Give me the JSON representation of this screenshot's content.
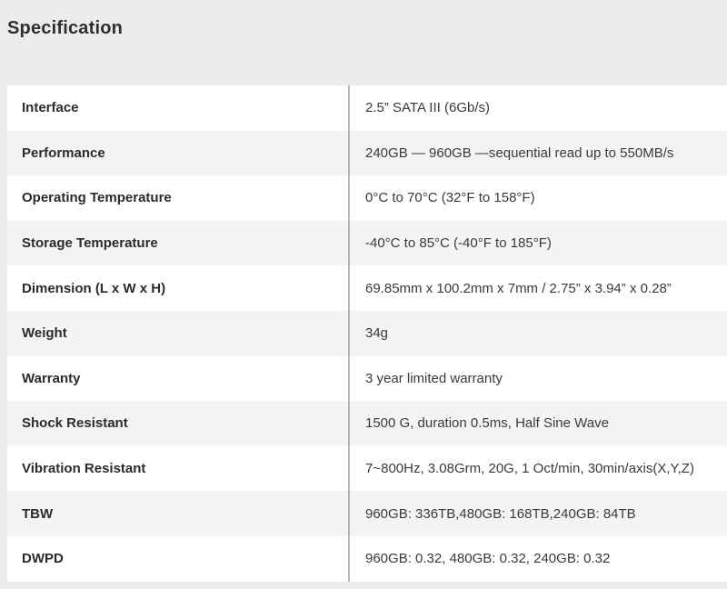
{
  "section": {
    "title": "Specification"
  },
  "specs": [
    {
      "label": "Interface",
      "value": "2.5” SATA III (6Gb/s)"
    },
    {
      "label": "Performance",
      "value": "240GB — 960GB —sequential read up to 550MB/s"
    },
    {
      "label": "Operating Temperature",
      "value": "0°C to 70°C (32°F to 158°F)"
    },
    {
      "label": "Storage Temperature",
      "value": "-40°C to 85°C (-40°F to 185°F)"
    },
    {
      "label": "Dimension (L x W x H)",
      "value": "69.85mm x 100.2mm x 7mm / 2.75” x 3.94” x 0.28”"
    },
    {
      "label": "Weight",
      "value": "34g"
    },
    {
      "label": "Warranty",
      "value": "3 year limited warranty"
    },
    {
      "label": "Shock Resistant",
      "value": "1500 G, duration 0.5ms, Half Sine Wave"
    },
    {
      "label": "Vibration Resistant",
      "value": "7~800Hz, 3.08Grm, 20G, 1 Oct/min, 30min/axis(X,Y,Z)"
    },
    {
      "label": "TBW",
      "value": "960GB: 336TB,480GB: 168TB,240GB: 84TB"
    },
    {
      "label": "DWPD",
      "value": "960GB: 0.32, 480GB: 0.32, 240GB: 0.32"
    }
  ]
}
